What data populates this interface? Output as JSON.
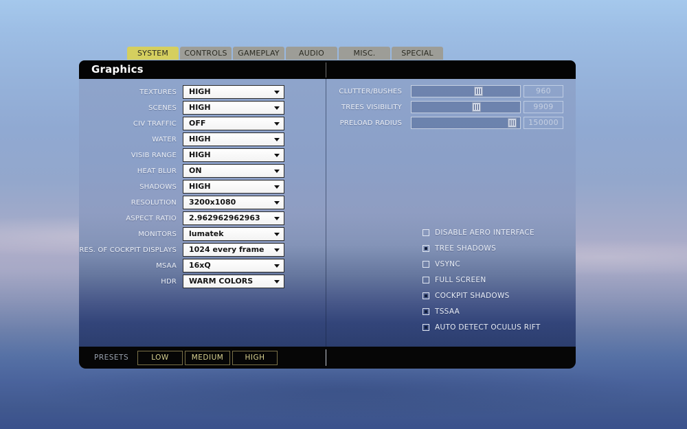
{
  "tabs": [
    {
      "label": "SYSTEM",
      "active": true
    },
    {
      "label": "CONTROLS",
      "active": false
    },
    {
      "label": "GAMEPLAY",
      "active": false
    },
    {
      "label": "AUDIO",
      "active": false
    },
    {
      "label": "MISC.",
      "active": false
    },
    {
      "label": "SPECIAL",
      "active": false
    }
  ],
  "dialog": {
    "title": "Graphics",
    "dropdowns": [
      {
        "label": "TEXTURES",
        "value": "HIGH"
      },
      {
        "label": "SCENES",
        "value": "HIGH"
      },
      {
        "label": "CIV TRAFFIC",
        "value": "OFF"
      },
      {
        "label": "WATER",
        "value": "HIGH"
      },
      {
        "label": "VISIB RANGE",
        "value": "HIGH"
      },
      {
        "label": "HEAT BLUR",
        "value": "ON"
      },
      {
        "label": "SHADOWS",
        "value": "HIGH"
      },
      {
        "label": "RESOLUTION",
        "value": "3200x1080"
      },
      {
        "label": "ASPECT RATIO",
        "value": "2.962962962963"
      },
      {
        "label": "MONITORS",
        "value": "lumatek"
      },
      {
        "label": "RES. OF COCKPIT DISPLAYS",
        "value": "1024 every frame"
      },
      {
        "label": "MSAA",
        "value": "16xQ"
      },
      {
        "label": "HDR",
        "value": "WARM COLORS"
      }
    ],
    "sliders": [
      {
        "label": "CLUTTER/BUSHES",
        "value": "960",
        "handle_pct": 62
      },
      {
        "label": "TREES VISIBILITY",
        "value": "9909",
        "handle_pct": 60
      },
      {
        "label": "PRELOAD RADIUS",
        "value": "150000",
        "handle_pct": 93
      }
    ],
    "checkboxes": [
      {
        "label": "DISABLE AERO INTERFACE",
        "checked": false
      },
      {
        "label": "TREE SHADOWS",
        "checked": true
      },
      {
        "label": "VSYNC",
        "checked": false
      },
      {
        "label": "FULL SCREEN",
        "checked": false
      },
      {
        "label": "COCKPIT SHADOWS",
        "checked": true
      },
      {
        "label": "TSSAA",
        "checked": true
      },
      {
        "label": "AUTO DETECT OCULUS RIFT",
        "checked": true
      }
    ],
    "footer": {
      "presets_label": "PRESETS",
      "preset_buttons": [
        "LOW",
        "MEDIUM",
        "HIGH"
      ]
    }
  },
  "colors": {
    "active_tab": "#d5cf5f",
    "inactive_tab": "#9d9d97",
    "header_bg": "#040404",
    "preset_button_text": "#d8d190",
    "panel_top": "#8ba0c8",
    "panel_bottom": "#2c3e6e"
  }
}
